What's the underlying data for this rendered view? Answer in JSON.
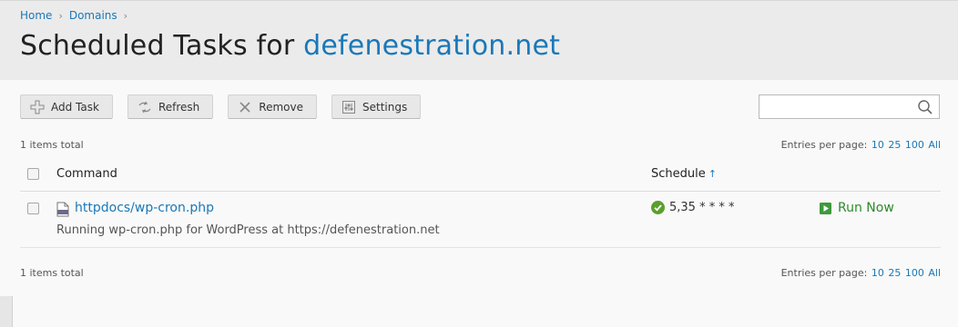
{
  "breadcrumb": {
    "items": [
      "Home",
      "Domains"
    ],
    "separator": "›"
  },
  "title": {
    "prefix": "Scheduled Tasks for ",
    "domain": "defenestration.net"
  },
  "toolbar": {
    "add_label": "Add Task",
    "refresh_label": "Refresh",
    "remove_label": "Remove",
    "settings_label": "Settings"
  },
  "search": {
    "placeholder": "",
    "value": ""
  },
  "summary": {
    "top": "1 items total",
    "bottom": "1 items total"
  },
  "per_page": {
    "label": "Entries per page:",
    "options": [
      "10",
      "25",
      "100",
      "All"
    ]
  },
  "table": {
    "columns": {
      "command": "Command",
      "schedule": "Schedule",
      "sort_arrow": "↑"
    },
    "rows": [
      {
        "command": "httpdocs/wp-cron.php",
        "description": "Running wp-cron.php for WordPress at https://defenestration.net",
        "schedule": "5,35 * * * *",
        "action": "Run Now"
      }
    ]
  },
  "colors": {
    "link": "#1a78b8",
    "success": "#5aa02c",
    "run": "#2e8a2e"
  }
}
